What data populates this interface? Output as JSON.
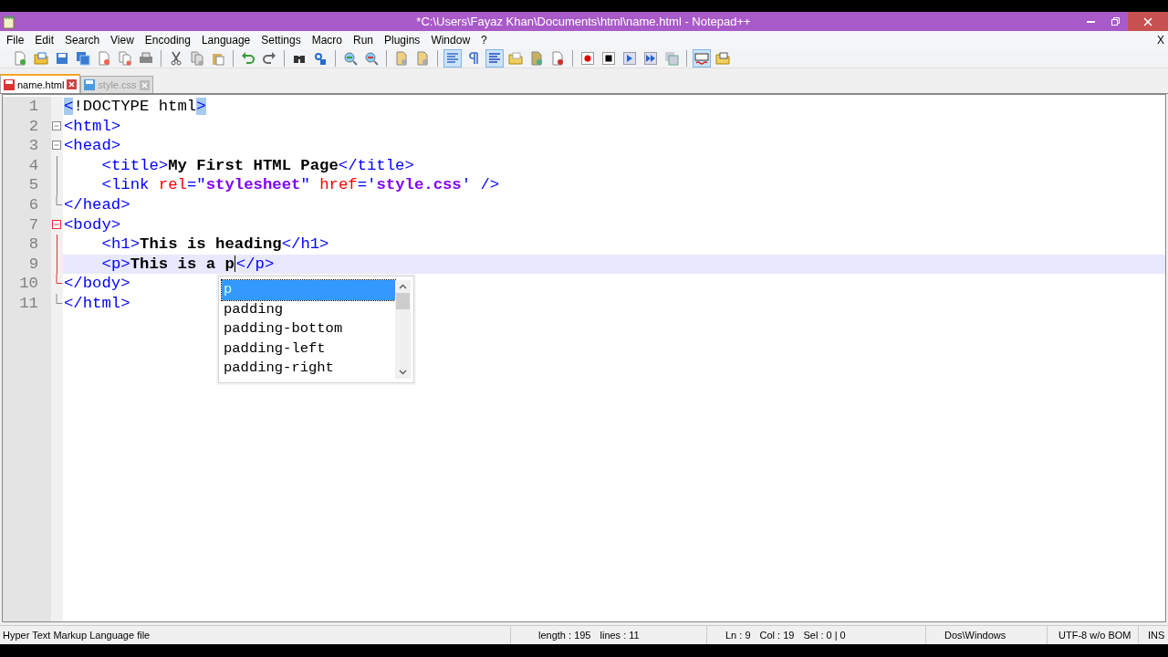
{
  "window": {
    "title": "*C:\\Users\\Fayaz Khan\\Documents\\html\\name.html - Notepad++"
  },
  "menu": [
    "File",
    "Edit",
    "Search",
    "View",
    "Encoding",
    "Language",
    "Settings",
    "Macro",
    "Run",
    "Plugins",
    "Window",
    "?"
  ],
  "menu_close": "X",
  "toolbar": [
    {
      "kind": "button",
      "pressed": false
    },
    {
      "kind": "button",
      "pressed": false
    },
    {
      "kind": "button",
      "pressed": false
    },
    {
      "kind": "button",
      "pressed": false
    },
    {
      "kind": "button",
      "pressed": false
    },
    {
      "kind": "button",
      "pressed": false
    },
    {
      "kind": "button",
      "pressed": false
    },
    {
      "kind": "separator"
    },
    {
      "kind": "button",
      "pressed": false
    },
    {
      "kind": "button",
      "pressed": false
    },
    {
      "kind": "button",
      "pressed": false
    },
    {
      "kind": "separator"
    },
    {
      "kind": "button",
      "pressed": false
    },
    {
      "kind": "button",
      "pressed": false
    },
    {
      "kind": "separator"
    },
    {
      "kind": "button",
      "pressed": false
    },
    {
      "kind": "button",
      "pressed": false
    },
    {
      "kind": "separator"
    },
    {
      "kind": "button",
      "pressed": false
    },
    {
      "kind": "button",
      "pressed": false
    },
    {
      "kind": "separator"
    },
    {
      "kind": "button",
      "pressed": false
    },
    {
      "kind": "button",
      "pressed": false
    },
    {
      "kind": "separator"
    },
    {
      "kind": "button",
      "pressed": true
    },
    {
      "kind": "button",
      "pressed": false
    },
    {
      "kind": "button",
      "pressed": true
    },
    {
      "kind": "button",
      "pressed": false
    },
    {
      "kind": "button",
      "pressed": false
    },
    {
      "kind": "button",
      "pressed": false
    },
    {
      "kind": "separator"
    },
    {
      "kind": "button",
      "pressed": false
    },
    {
      "kind": "button",
      "pressed": false
    },
    {
      "kind": "button",
      "pressed": false
    },
    {
      "kind": "button",
      "pressed": false
    },
    {
      "kind": "button",
      "pressed": false
    },
    {
      "kind": "separator"
    },
    {
      "kind": "button",
      "pressed": true
    },
    {
      "kind": "button",
      "pressed": false
    }
  ],
  "tabs": [
    {
      "label": "name.html",
      "selected": true
    },
    {
      "label": "style.css",
      "selected": false
    }
  ],
  "editor": {
    "lines": [
      {
        "number": "1",
        "current": false,
        "indent": false,
        "tokens": [
          {
            "kind": "tag",
            "text": "<",
            "highlight": true
          },
          {
            "kind": "plain",
            "text": "!DOCTYPE html"
          },
          {
            "kind": "tag",
            "text": ">",
            "highlight": true
          }
        ]
      },
      {
        "number": "2",
        "fold": {
          "kind": "box",
          "active": false
        },
        "current": false,
        "indent": false,
        "tokens": [
          {
            "kind": "tag",
            "text": "<html>"
          }
        ]
      },
      {
        "number": "3",
        "fold": {
          "kind": "box",
          "active": false
        },
        "current": false,
        "indent": false,
        "tokens": [
          {
            "kind": "tag",
            "text": "<head>"
          }
        ]
      },
      {
        "number": "4",
        "fold": {
          "kind": "line",
          "active": false
        },
        "current": false,
        "indent": true,
        "tokens": [
          {
            "kind": "tag",
            "text": "<title>"
          },
          {
            "kind": "text",
            "text": "My First HTML Page"
          },
          {
            "kind": "tag",
            "text": "</title>"
          }
        ]
      },
      {
        "number": "5",
        "fold": {
          "kind": "line",
          "active": false
        },
        "current": false,
        "indent": true,
        "tokens": [
          {
            "kind": "tag",
            "text": "<link "
          },
          {
            "kind": "attr",
            "text": "rel"
          },
          {
            "kind": "tag",
            "text": "=\""
          },
          {
            "kind": "string",
            "text": "stylesheet"
          },
          {
            "kind": "tag",
            "text": "\" "
          },
          {
            "kind": "attr",
            "text": "href"
          },
          {
            "kind": "tag",
            "text": "='"
          },
          {
            "kind": "string",
            "text": "style.css"
          },
          {
            "kind": "tag",
            "text": "' />"
          }
        ]
      },
      {
        "number": "6",
        "fold": {
          "kind": "end",
          "active": false
        },
        "current": false,
        "indent": false,
        "tokens": [
          {
            "kind": "tag",
            "text": "</head>"
          }
        ]
      },
      {
        "number": "7",
        "fold": {
          "kind": "box",
          "active": true
        },
        "current": false,
        "indent": false,
        "tokens": [
          {
            "kind": "tag",
            "text": "<body>"
          }
        ]
      },
      {
        "number": "8",
        "fold": {
          "kind": "line",
          "active": true
        },
        "current": false,
        "indent": true,
        "tokens": [
          {
            "kind": "tag",
            "text": "<h1>"
          },
          {
            "kind": "text",
            "text": "This is heading"
          },
          {
            "kind": "tag",
            "text": "</h1>"
          }
        ]
      },
      {
        "number": "9",
        "fold": {
          "kind": "line",
          "active": true
        },
        "current": true,
        "indent": true,
        "tokens": [
          {
            "kind": "tag",
            "text": "<p>"
          },
          {
            "kind": "text",
            "text": "This is a p",
            "caret": true
          },
          {
            "kind": "tag",
            "text": "</p>"
          }
        ]
      },
      {
        "number": "10",
        "fold": {
          "kind": "end",
          "active": true
        },
        "current": false,
        "indent": false,
        "tokens": [
          {
            "kind": "tag",
            "text": "</body>"
          }
        ]
      },
      {
        "number": "11",
        "fold": {
          "kind": "end",
          "active": false
        },
        "current": false,
        "indent": false,
        "tokens": [
          {
            "kind": "tag",
            "text": "</html>"
          }
        ]
      }
    ]
  },
  "autocomplete": {
    "items": [
      {
        "label": "p",
        "selected": true
      },
      {
        "label": "padding",
        "selected": false
      },
      {
        "label": "padding-bottom",
        "selected": false
      },
      {
        "label": "padding-left",
        "selected": false
      },
      {
        "label": "padding-right",
        "selected": false
      }
    ]
  },
  "status_bar": {
    "file_type": "Hyper Text Markup Language file",
    "length": "length : 195",
    "lines": "lines : 11",
    "ln": "Ln : 9",
    "col": "Col : 19",
    "sel": "Sel : 0 | 0",
    "eol": "Dos\\Windows",
    "encoding": "UTF-8 w/o BOM",
    "mode": "INS"
  }
}
